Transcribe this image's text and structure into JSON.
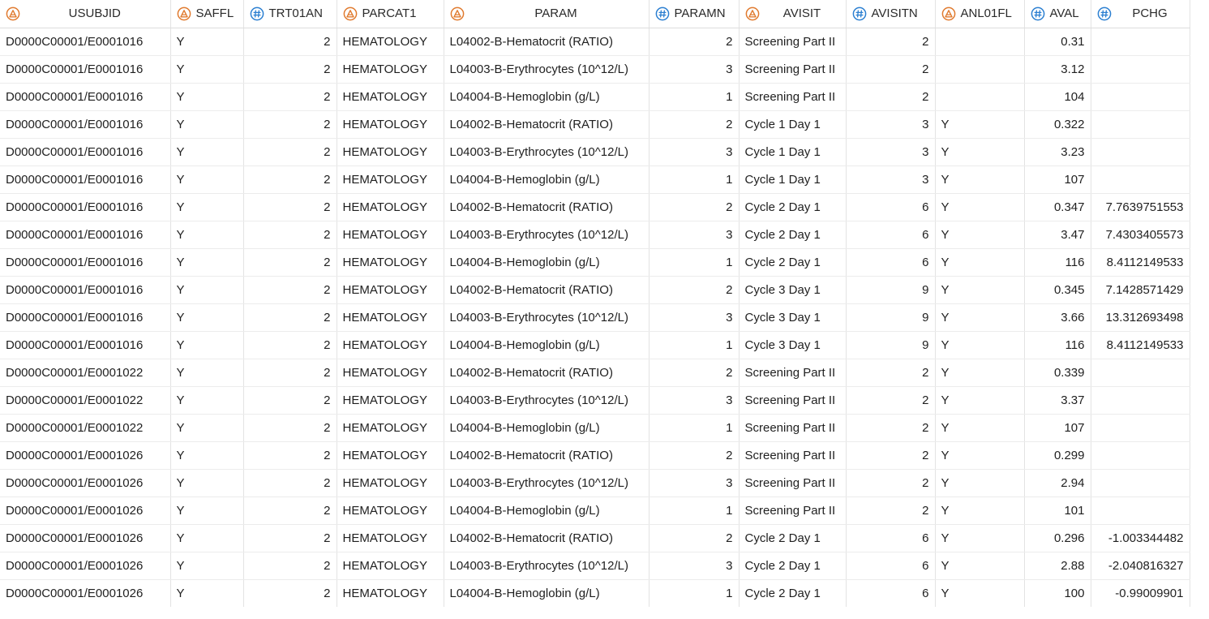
{
  "columns": [
    {
      "name": "USUBJID",
      "type": "char",
      "align": "left"
    },
    {
      "name": "SAFFL",
      "type": "char",
      "align": "left"
    },
    {
      "name": "TRT01AN",
      "type": "num",
      "align": "right"
    },
    {
      "name": "PARCAT1",
      "type": "char",
      "align": "left"
    },
    {
      "name": "PARAM",
      "type": "char",
      "align": "left"
    },
    {
      "name": "PARAMN",
      "type": "num",
      "align": "right"
    },
    {
      "name": "AVISIT",
      "type": "char",
      "align": "left"
    },
    {
      "name": "AVISITN",
      "type": "num",
      "align": "right"
    },
    {
      "name": "ANL01FL",
      "type": "char",
      "align": "left"
    },
    {
      "name": "AVAL",
      "type": "num",
      "align": "right"
    },
    {
      "name": "PCHG",
      "type": "num",
      "align": "right"
    }
  ],
  "colors": {
    "char_icon": "#e07a2e",
    "num_icon": "#2b7fd1"
  },
  "rows": [
    [
      "D0000C00001/E0001016",
      "Y",
      "2",
      "HEMATOLOGY",
      "L04002-B-Hematocrit (RATIO)",
      "2",
      "Screening Part II",
      "2",
      "",
      "0.31",
      ""
    ],
    [
      "D0000C00001/E0001016",
      "Y",
      "2",
      "HEMATOLOGY",
      "L04003-B-Erythrocytes (10^12/L)",
      "3",
      "Screening Part II",
      "2",
      "",
      "3.12",
      ""
    ],
    [
      "D0000C00001/E0001016",
      "Y",
      "2",
      "HEMATOLOGY",
      "L04004-B-Hemoglobin (g/L)",
      "1",
      "Screening Part II",
      "2",
      "",
      "104",
      ""
    ],
    [
      "D0000C00001/E0001016",
      "Y",
      "2",
      "HEMATOLOGY",
      "L04002-B-Hematocrit (RATIO)",
      "2",
      "Cycle 1 Day 1",
      "3",
      "Y",
      "0.322",
      ""
    ],
    [
      "D0000C00001/E0001016",
      "Y",
      "2",
      "HEMATOLOGY",
      "L04003-B-Erythrocytes (10^12/L)",
      "3",
      "Cycle 1 Day 1",
      "3",
      "Y",
      "3.23",
      ""
    ],
    [
      "D0000C00001/E0001016",
      "Y",
      "2",
      "HEMATOLOGY",
      "L04004-B-Hemoglobin (g/L)",
      "1",
      "Cycle 1 Day 1",
      "3",
      "Y",
      "107",
      ""
    ],
    [
      "D0000C00001/E0001016",
      "Y",
      "2",
      "HEMATOLOGY",
      "L04002-B-Hematocrit (RATIO)",
      "2",
      "Cycle 2 Day 1",
      "6",
      "Y",
      "0.347",
      "7.7639751553"
    ],
    [
      "D0000C00001/E0001016",
      "Y",
      "2",
      "HEMATOLOGY",
      "L04003-B-Erythrocytes (10^12/L)",
      "3",
      "Cycle 2 Day 1",
      "6",
      "Y",
      "3.47",
      "7.4303405573"
    ],
    [
      "D0000C00001/E0001016",
      "Y",
      "2",
      "HEMATOLOGY",
      "L04004-B-Hemoglobin (g/L)",
      "1",
      "Cycle 2 Day 1",
      "6",
      "Y",
      "116",
      "8.4112149533"
    ],
    [
      "D0000C00001/E0001016",
      "Y",
      "2",
      "HEMATOLOGY",
      "L04002-B-Hematocrit (RATIO)",
      "2",
      "Cycle 3 Day 1",
      "9",
      "Y",
      "0.345",
      "7.1428571429"
    ],
    [
      "D0000C00001/E0001016",
      "Y",
      "2",
      "HEMATOLOGY",
      "L04003-B-Erythrocytes (10^12/L)",
      "3",
      "Cycle 3 Day 1",
      "9",
      "Y",
      "3.66",
      "13.312693498"
    ],
    [
      "D0000C00001/E0001016",
      "Y",
      "2",
      "HEMATOLOGY",
      "L04004-B-Hemoglobin (g/L)",
      "1",
      "Cycle 3 Day 1",
      "9",
      "Y",
      "116",
      "8.4112149533"
    ],
    [
      "D0000C00001/E0001022",
      "Y",
      "2",
      "HEMATOLOGY",
      "L04002-B-Hematocrit (RATIO)",
      "2",
      "Screening Part II",
      "2",
      "Y",
      "0.339",
      ""
    ],
    [
      "D0000C00001/E0001022",
      "Y",
      "2",
      "HEMATOLOGY",
      "L04003-B-Erythrocytes (10^12/L)",
      "3",
      "Screening Part II",
      "2",
      "Y",
      "3.37",
      ""
    ],
    [
      "D0000C00001/E0001022",
      "Y",
      "2",
      "HEMATOLOGY",
      "L04004-B-Hemoglobin (g/L)",
      "1",
      "Screening Part II",
      "2",
      "Y",
      "107",
      ""
    ],
    [
      "D0000C00001/E0001026",
      "Y",
      "2",
      "HEMATOLOGY",
      "L04002-B-Hematocrit (RATIO)",
      "2",
      "Screening Part II",
      "2",
      "Y",
      "0.299",
      ""
    ],
    [
      "D0000C00001/E0001026",
      "Y",
      "2",
      "HEMATOLOGY",
      "L04003-B-Erythrocytes (10^12/L)",
      "3",
      "Screening Part II",
      "2",
      "Y",
      "2.94",
      ""
    ],
    [
      "D0000C00001/E0001026",
      "Y",
      "2",
      "HEMATOLOGY",
      "L04004-B-Hemoglobin (g/L)",
      "1",
      "Screening Part II",
      "2",
      "Y",
      "101",
      ""
    ],
    [
      "D0000C00001/E0001026",
      "Y",
      "2",
      "HEMATOLOGY",
      "L04002-B-Hematocrit (RATIO)",
      "2",
      "Cycle 2 Day 1",
      "6",
      "Y",
      "0.296",
      "-1.003344482"
    ],
    [
      "D0000C00001/E0001026",
      "Y",
      "2",
      "HEMATOLOGY",
      "L04003-B-Erythrocytes (10^12/L)",
      "3",
      "Cycle 2 Day 1",
      "6",
      "Y",
      "2.88",
      "-2.040816327"
    ],
    [
      "D0000C00001/E0001026",
      "Y",
      "2",
      "HEMATOLOGY",
      "L04004-B-Hemoglobin (g/L)",
      "1",
      "Cycle 2 Day 1",
      "6",
      "Y",
      "100",
      "-0.99009901"
    ]
  ]
}
